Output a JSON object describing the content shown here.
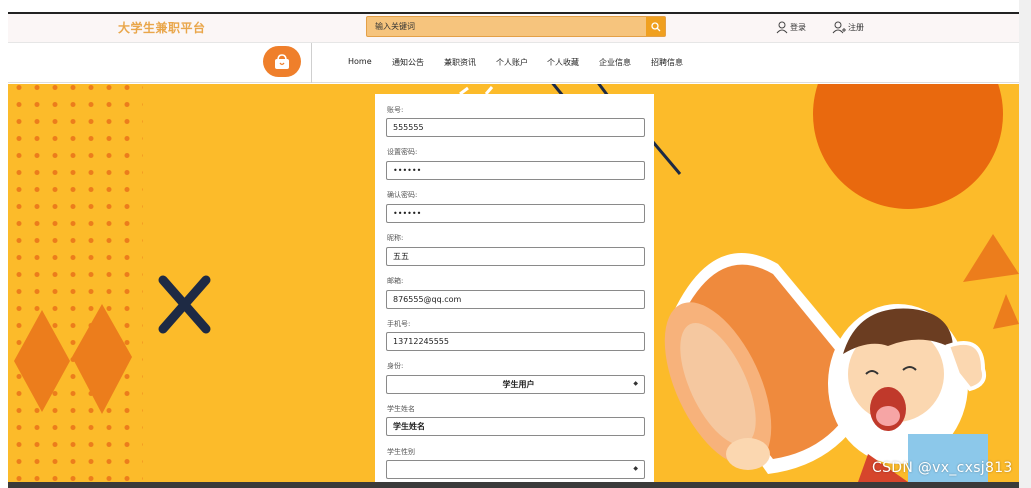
{
  "header": {
    "site_title": "大学生兼职平台",
    "search_placeholder": "输入关键词",
    "login": "登录",
    "register": "注册"
  },
  "nav": {
    "items": [
      "Home",
      "通知公告",
      "兼职资讯",
      "个人账户",
      "个人收藏",
      "企业信息",
      "招聘信息"
    ]
  },
  "form": {
    "fields": [
      {
        "label": "账号:",
        "value": "555555"
      },
      {
        "label": "设置密码:",
        "value": "••••••"
      },
      {
        "label": "确认密码:",
        "value": "••••••"
      },
      {
        "label": "昵称:",
        "value": "五五"
      },
      {
        "label": "邮箱:",
        "value": "876555@qq.com"
      },
      {
        "label": "手机号:",
        "value": "13712245555"
      },
      {
        "label": "身份:",
        "value": "学生用户"
      },
      {
        "label": "学生姓名",
        "value": "学生姓名"
      },
      {
        "label": "学生性别",
        "value": ""
      }
    ]
  },
  "watermark": "CSDN @vx_cxsj813",
  "colors": {
    "banner": "#fcbb2a",
    "accent_orange": "#ec7d1c",
    "title_color": "#e9a64a",
    "search_bg": "#f6c47d"
  }
}
